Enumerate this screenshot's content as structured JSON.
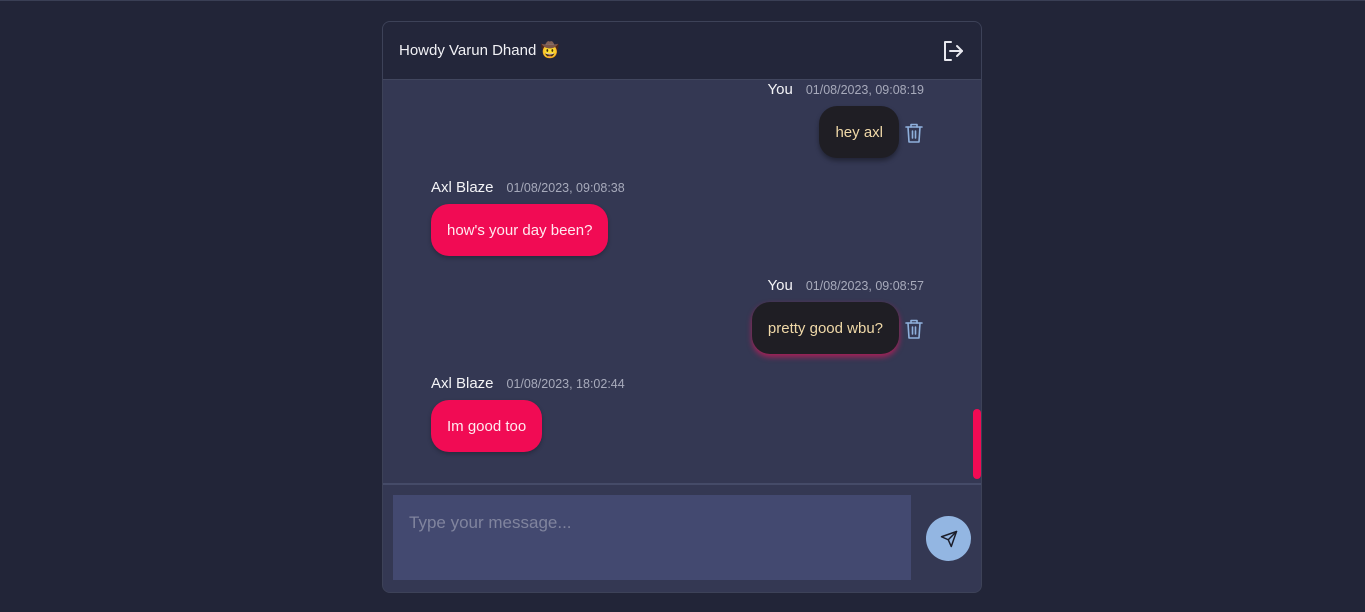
{
  "header": {
    "greeting": "Howdy Varun Dhand 🤠",
    "logout_icon": "logout-icon"
  },
  "messages": [
    {
      "sender": "You",
      "time": "01/08/2023, 09:08:19",
      "text": "hey axl",
      "own": true
    },
    {
      "sender": "Axl Blaze",
      "time": "01/08/2023, 09:08:38",
      "text": "how's your day been?",
      "own": false
    },
    {
      "sender": "You",
      "time": "01/08/2023, 09:08:57",
      "text": "pretty good wbu?",
      "own": true
    },
    {
      "sender": "Axl Blaze",
      "time": "01/08/2023, 18:02:44",
      "text": "Im good too",
      "own": false
    }
  ],
  "composer": {
    "placeholder": "Type your message...",
    "send_icon": "send-icon"
  },
  "colors": {
    "page_bg": "#222538",
    "panel_bg": "#343853",
    "header_bg": "#23263a",
    "own_bubble": "#1f1e24",
    "other_bubble": "#f10b54",
    "accent": "#f10b54",
    "send_button": "#93b6e2",
    "trash_icon": "#8fb0dc"
  }
}
